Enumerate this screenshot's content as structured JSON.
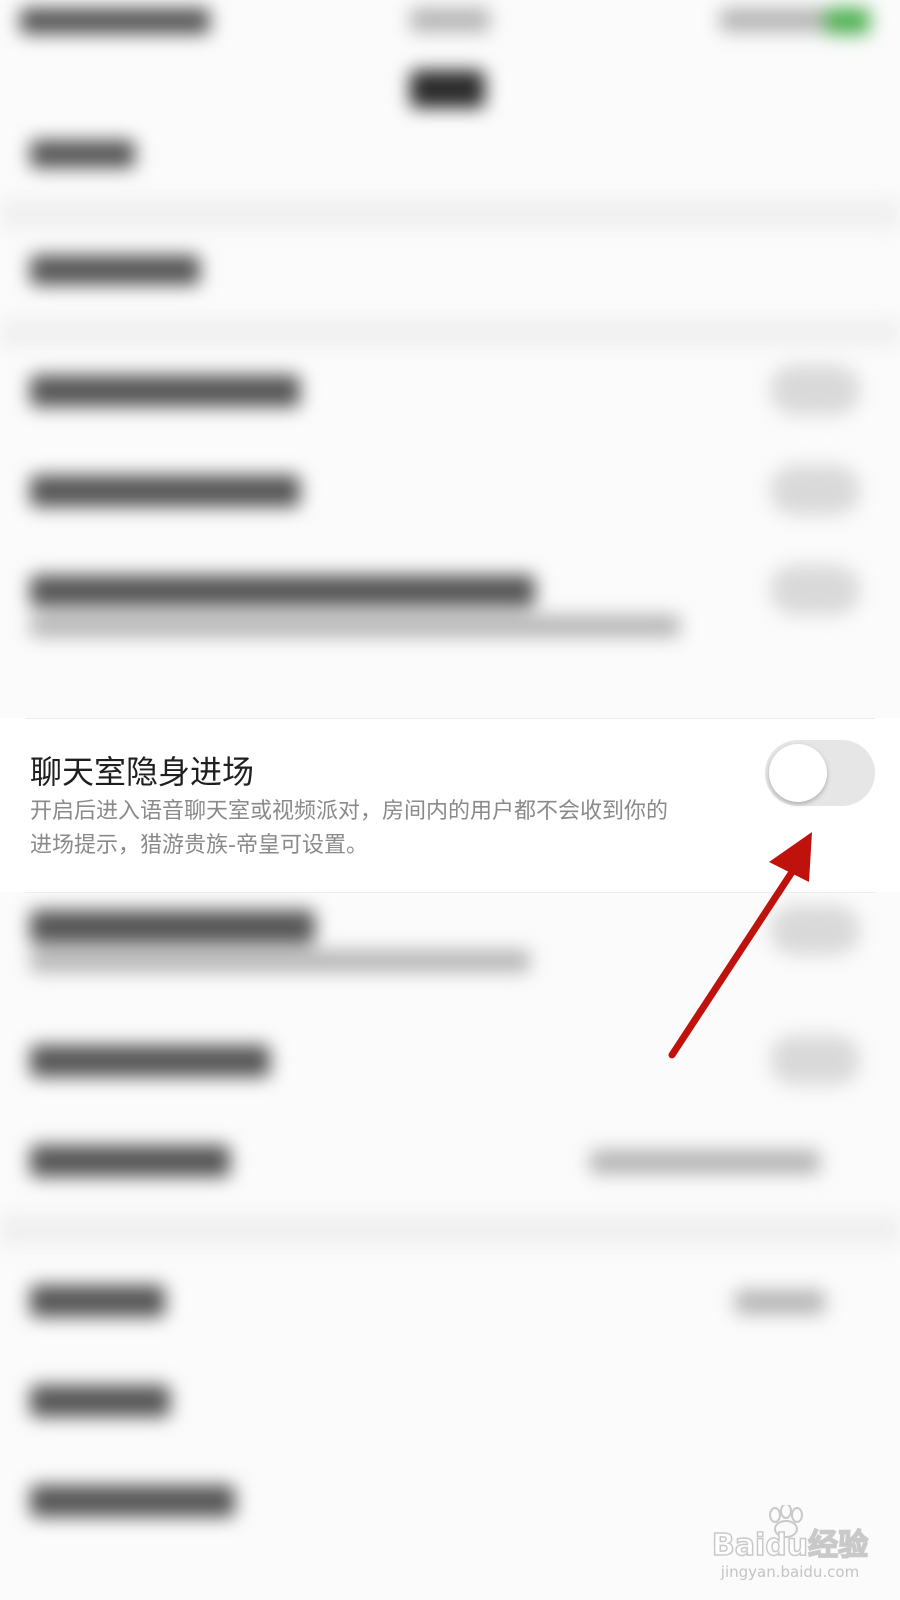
{
  "setting": {
    "title": "聊天室隐身进场",
    "description_line1": "开启后进入语音聊天室或视频派对，房间内的用户都不会收到你的",
    "description_line2": "进场提示，猎游贵族-帝皇可设置。",
    "toggle_on": false
  },
  "colors": {
    "arrow": "#c0120c",
    "toggle_track_off": "#e6e6e6",
    "title_text": "#1f1f1f",
    "desc_text": "#8a8a8a"
  },
  "watermark": {
    "brand": "Baidu经验",
    "url": "jingyan.baidu.com"
  }
}
